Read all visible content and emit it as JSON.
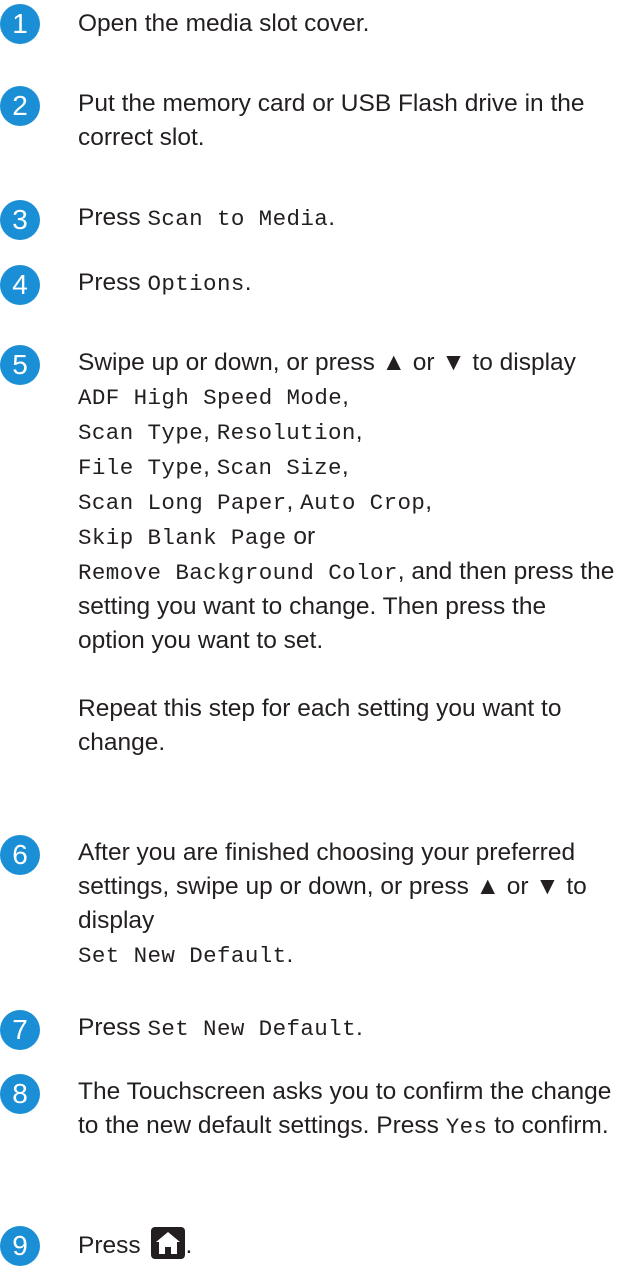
{
  "step_numbers": [
    "1",
    "2",
    "3",
    "4",
    "5",
    "6",
    "7",
    "8",
    "9"
  ],
  "steps": {
    "s1": {
      "text": "Open the media slot cover."
    },
    "s2": {
      "text": "Put the memory card or USB Flash drive in the correct slot."
    },
    "s3": {
      "prefix": "Press",
      "code": "Scan to Media",
      "suffix": "."
    },
    "s4": {
      "prefix": "Press",
      "code": "Options",
      "suffix": "."
    },
    "s5": {
      "intro": "Swipe up or down, or press ▲ or ▼ to display",
      "opt_adf": "ADF High Speed Mode",
      "opt_scan_type": "Scan Type",
      "opt_resolution": "Resolution",
      "opt_file_type": "File Type",
      "opt_scan_size": "Scan Size",
      "opt_long_paper": "Scan Long Paper",
      "opt_auto_crop": "Auto Crop",
      "opt_skip_blank": "Skip Blank Page",
      "or_word": "or",
      "opt_remove_bg": "Remove Background Color",
      "and_word": "and",
      "outro": "then press the setting you want to change. Then press the option you want to set.",
      "repeat": "Repeat this step for each setting you want to change."
    },
    "s6": {
      "text": "After you are finished choosing your preferred settings, swipe up or down, or press ▲ or ▼ to display",
      "code": "Set New Default",
      "suffix": "."
    },
    "s7": {
      "prefix": "Press",
      "code": "Set New Default",
      "suffix": "."
    },
    "s8": {
      "text": "The Touchscreen asks you to confirm the change to the new default settings.",
      "prefix": "Press",
      "code": "Yes",
      "suffix": "to confirm."
    },
    "s9": {
      "prefix": "Press",
      "icon": "home-icon",
      "suffix": "."
    }
  },
  "colors": {
    "accent": "#1a8fd6",
    "text": "#231f20"
  }
}
